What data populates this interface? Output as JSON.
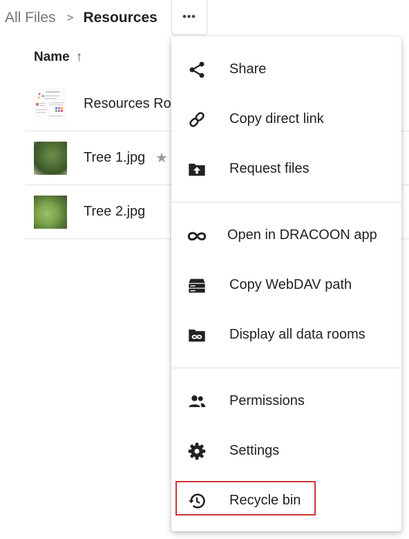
{
  "breadcrumb": {
    "root": "All Files",
    "separator": ">",
    "current": "Resources"
  },
  "toolbar": {
    "more_label": "•••"
  },
  "list": {
    "column_header": "Name",
    "sort_indicator": "↑",
    "files": [
      {
        "name": "Resources Ro",
        "thumbnail": "document-preview",
        "favorite": false
      },
      {
        "name": "Tree 1.jpg",
        "thumbnail": "tree-photo",
        "favorite": true
      },
      {
        "name": "Tree 2.jpg",
        "thumbnail": "tree-photo",
        "favorite": false
      }
    ],
    "favorite_icon": "★"
  },
  "context_menu": {
    "items": [
      {
        "label": "Share",
        "icon": "share-icon"
      },
      {
        "label": "Copy direct link",
        "icon": "link-icon"
      },
      {
        "label": "Request files",
        "icon": "folder-upload-icon"
      },
      {
        "label": "Open in DRACOON app",
        "icon": "dracoon-icon"
      },
      {
        "label": "Copy WebDAV path",
        "icon": "drive-icon"
      },
      {
        "label": "Display all data rooms",
        "icon": "dataroom-folder-icon"
      },
      {
        "label": "Permissions",
        "icon": "people-icon"
      },
      {
        "label": "Settings",
        "icon": "gear-icon"
      },
      {
        "label": "Recycle bin",
        "icon": "history-icon"
      }
    ],
    "highlighted_item": "Recycle bin",
    "highlight_color": "#cc3333"
  }
}
